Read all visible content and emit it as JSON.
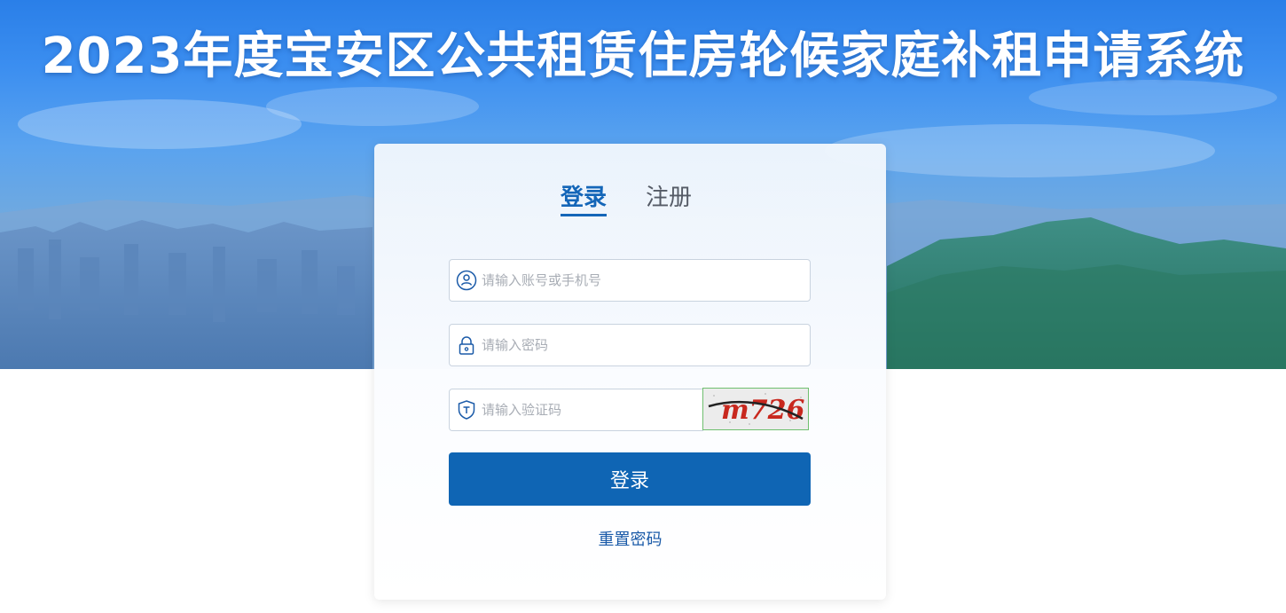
{
  "header": {
    "title": "2023年度宝安区公共租赁住房轮候家庭补租申请系统"
  },
  "tabs": [
    {
      "label": "登录",
      "active": true
    },
    {
      "label": "注册",
      "active": false
    }
  ],
  "form": {
    "account": {
      "placeholder": "请输入账号或手机号",
      "value": "",
      "icon": "user-icon"
    },
    "password": {
      "placeholder": "请输入密码",
      "value": "",
      "icon": "lock-icon"
    },
    "captcha": {
      "placeholder": "请输入验证码",
      "value": "",
      "icon": "shield-icon",
      "image_text": "m726"
    }
  },
  "login_button": "登录",
  "reset_link": "重置密码",
  "colors": {
    "primary": "#0f65b4",
    "tab_active": "#1466b8",
    "link": "#1a5aa8"
  }
}
